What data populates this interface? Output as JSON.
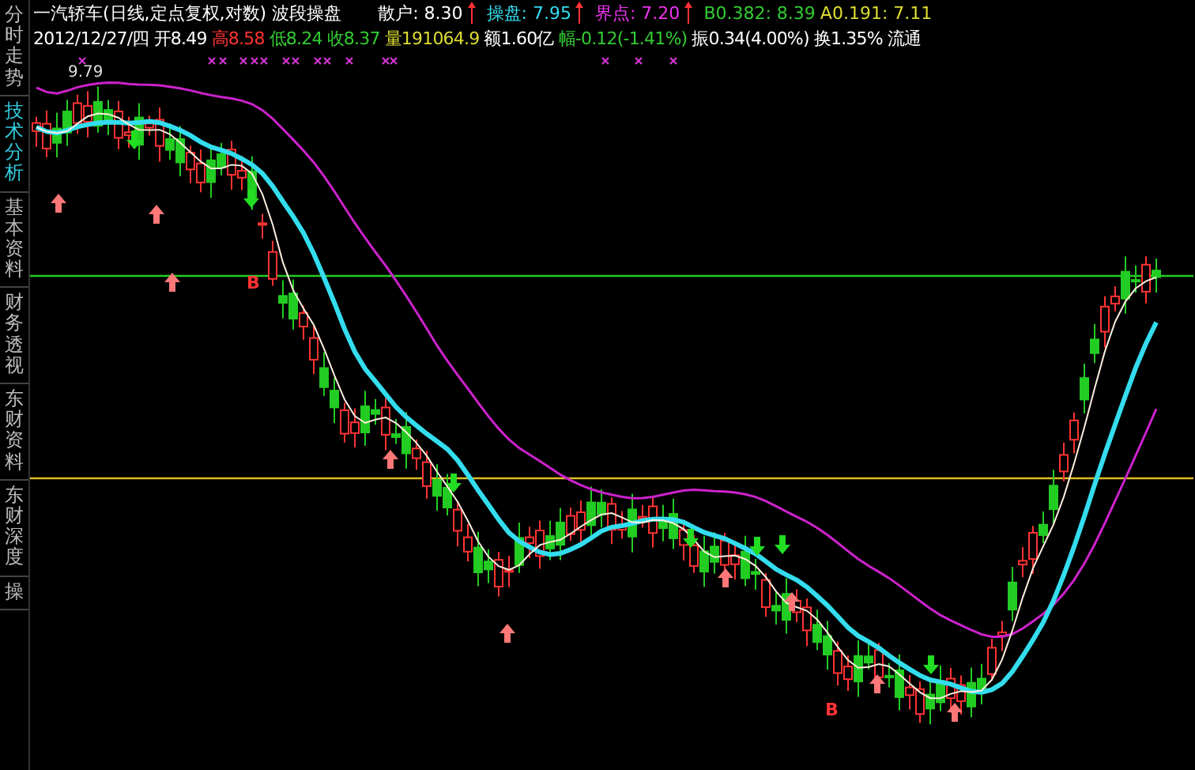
{
  "sidebar": {
    "tabs": [
      {
        "label": "分时走势",
        "selected": false
      },
      {
        "label": "技术分析",
        "selected": true
      },
      {
        "label": "基本资料",
        "selected": false
      },
      {
        "label": "财务透视",
        "selected": false
      },
      {
        "label": "东财资料",
        "selected": false
      },
      {
        "label": "东财深度",
        "selected": false
      },
      {
        "label": "操",
        "selected": false
      }
    ]
  },
  "header": {
    "title": "一汽轿车(日线,定点复权,对数) 波段操盘",
    "indicators": [
      {
        "text": "散户: 8.30",
        "color": "#ffffff",
        "marker": true
      },
      {
        "text": "操盘: 7.95",
        "color": "#33ddee",
        "marker": true
      },
      {
        "text": "界点: 7.20",
        "color": "#ee33ee",
        "marker": true
      },
      {
        "text": "B0.382: 8.39",
        "color": "#33cc33",
        "marker": false
      },
      {
        "text": "A0.191: 7.11",
        "color": "#dddd33",
        "marker": false
      }
    ],
    "quote": [
      {
        "text": "2012/12/27/四",
        "color": "#ffffff"
      },
      {
        "text": "开8.49",
        "color": "#ffffff"
      },
      {
        "text": "高8.58",
        "color": "#ff3333"
      },
      {
        "text": "低8.24",
        "color": "#33cc33"
      },
      {
        "text": "收8.37",
        "color": "#33cc33"
      },
      {
        "text": "量191064.9",
        "color": "#dddd33"
      },
      {
        "text": "额1.60亿",
        "color": "#ffffff"
      },
      {
        "text": "幅-0.12(-1.41%)",
        "color": "#33cc33"
      },
      {
        "text": "振0.34(4.00%)",
        "color": "#ffffff"
      },
      {
        "text": "换1.35%",
        "color": "#ffffff"
      },
      {
        "text": "流通",
        "color": "#ffffff"
      }
    ]
  },
  "chart": {
    "peak_label": "9.79",
    "signals": [
      "B",
      "B"
    ]
  }
}
